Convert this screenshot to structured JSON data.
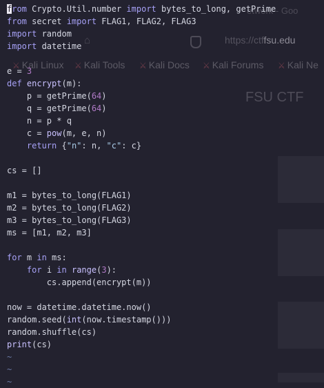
{
  "background_browser": {
    "tab_title": "etwork - Goo",
    "url_prefix": "https://ctf",
    "url_domain": "fsu.edu",
    "bookmarks": [
      "Kali Linux",
      "Kali Tools",
      "Kali Docs",
      "Kali Forums",
      "Kali Ne"
    ],
    "page_heading": "FSU CTF"
  },
  "editor": {
    "lines": [
      [
        [
          "kw",
          "from"
        ],
        [
          "t",
          " Crypto.Util.number "
        ],
        [
          "kw",
          "import"
        ],
        [
          "t",
          " bytes_to_long, getPrime"
        ]
      ],
      [
        [
          "kw",
          "from"
        ],
        [
          "t",
          " secret "
        ],
        [
          "kw",
          "import"
        ],
        [
          "t",
          " FLAG1, FLAG2, FLAG3"
        ]
      ],
      [
        [
          "kw",
          "import"
        ],
        [
          "t",
          " random"
        ]
      ],
      [
        [
          "kw",
          "import"
        ],
        [
          "t",
          " datetime"
        ]
      ],
      [],
      [
        [
          "t",
          "e = "
        ],
        [
          "num",
          "3"
        ]
      ],
      [
        [
          "kw",
          "def"
        ],
        [
          "t",
          " "
        ],
        [
          "fn",
          "encrypt"
        ],
        [
          "t",
          "(m):"
        ]
      ],
      [
        [
          "t",
          "    p = getPrime("
        ],
        [
          "num",
          "64"
        ],
        [
          "t",
          ")"
        ]
      ],
      [
        [
          "t",
          "    q = getPrime("
        ],
        [
          "num",
          "64"
        ],
        [
          "t",
          ")"
        ]
      ],
      [
        [
          "t",
          "    n = p * q"
        ]
      ],
      [
        [
          "t",
          "    c = "
        ],
        [
          "fn",
          "pow"
        ],
        [
          "t",
          "(m, e, n)"
        ]
      ],
      [
        [
          "t",
          "    "
        ],
        [
          "kw",
          "return"
        ],
        [
          "t",
          " {"
        ],
        [
          "str",
          "\"n\""
        ],
        [
          "t",
          ": n, "
        ],
        [
          "str",
          "\"c\""
        ],
        [
          "t",
          ": c}"
        ]
      ],
      [],
      [
        [
          "t",
          "cs = []"
        ]
      ],
      [],
      [
        [
          "t",
          "m1 = bytes_to_long(FLAG1)"
        ]
      ],
      [
        [
          "t",
          "m2 = bytes_to_long(FLAG2)"
        ]
      ],
      [
        [
          "t",
          "m3 = bytes_to_long(FLAG3)"
        ]
      ],
      [
        [
          "t",
          "ms = [m1, m2, m3]"
        ]
      ],
      [],
      [
        [
          "kw",
          "for"
        ],
        [
          "t",
          " m "
        ],
        [
          "kw",
          "in"
        ],
        [
          "t",
          " ms:"
        ]
      ],
      [
        [
          "t",
          "    "
        ],
        [
          "kw",
          "for"
        ],
        [
          "t",
          " i "
        ],
        [
          "kw",
          "in"
        ],
        [
          "t",
          " "
        ],
        [
          "fn",
          "range"
        ],
        [
          "t",
          "("
        ],
        [
          "num",
          "3"
        ],
        [
          "t",
          "):"
        ]
      ],
      [
        [
          "t",
          "        cs.append(encrypt(m))"
        ]
      ],
      [],
      [
        [
          "t",
          "now = datetime.datetime.now()"
        ]
      ],
      [
        [
          "t",
          "random.seed("
        ],
        [
          "fn",
          "int"
        ],
        [
          "t",
          "(now.timestamp()))"
        ]
      ],
      [
        [
          "t",
          "random.shuffle(cs)"
        ]
      ],
      [
        [
          "fn",
          "print"
        ],
        [
          "t",
          "(cs)"
        ]
      ],
      [
        [
          "tl",
          "~"
        ]
      ],
      [
        [
          "tl",
          "~"
        ]
      ],
      [
        [
          "tl",
          "~"
        ]
      ]
    ]
  }
}
